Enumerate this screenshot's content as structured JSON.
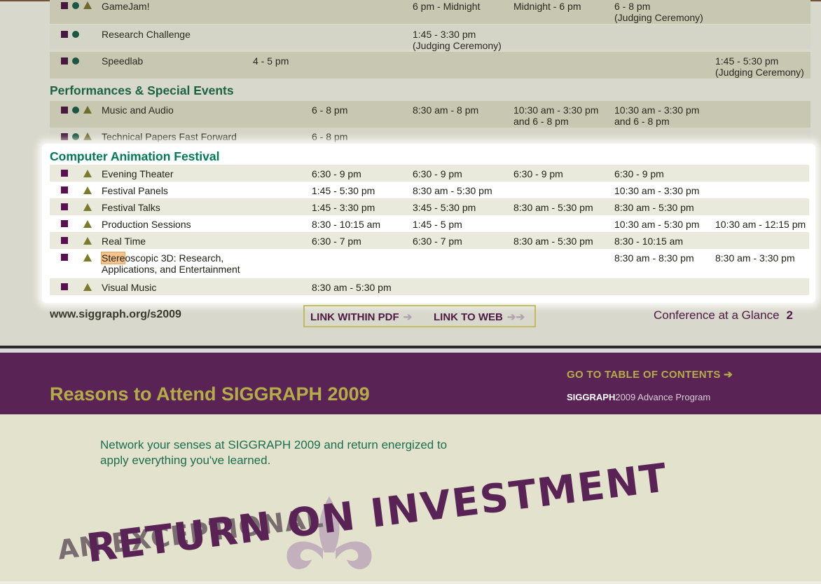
{
  "page1": {
    "upper_rows": [
      {
        "name": "GameJam!",
        "cells": [
          "",
          "",
          "6 pm - Midnight",
          "Midnight - 6 pm",
          "6 - 8 pm\n(Judging Ceremony)",
          ""
        ]
      },
      {
        "name": "Research Challenge",
        "cells": [
          "",
          "",
          "1:45 - 3:30 pm\n(Judging Ceremony)",
          "",
          "",
          ""
        ]
      },
      {
        "name": "Speedlab",
        "cells": [
          "4 - 5 pm",
          "",
          "",
          "",
          "",
          "1:45 - 5:30 pm\n(Judging Ceremony)"
        ]
      }
    ],
    "performances_section": "Performances & Special Events",
    "performances_rows": [
      {
        "name": "Music and Audio",
        "cells": [
          "6 - 8 pm",
          "8:30 am - 8 pm",
          "10:30 am - 3:30 pm\nand 6 - 8 pm",
          "10:30 am - 3:30 pm\nand 6 - 8 pm",
          ""
        ]
      },
      {
        "name": "Technical Papers Fast Forward",
        "cells": [
          "6 - 8 pm",
          "",
          "",
          "",
          ""
        ]
      }
    ],
    "caf": {
      "section": "Computer Animation Festival",
      "rows": [
        {
          "name": "Evening Theater",
          "cells": [
            "6:30 - 9 pm",
            "6:30 - 9 pm",
            "6:30 - 9 pm",
            "6:30 - 9 pm",
            ""
          ]
        },
        {
          "name": "Festival Panels",
          "cells": [
            "1:45 - 5:30 pm",
            "8:30 am - 5:30 pm",
            "",
            "10:30 am - 3:30 pm",
            ""
          ]
        },
        {
          "name": "Festival Talks",
          "cells": [
            "1:45 - 3:30 pm",
            "3:45 - 5:30 pm",
            "8:30 am - 5:30 pm",
            "8:30 am - 5:30 pm",
            ""
          ]
        },
        {
          "name": "Production Sessions",
          "cells": [
            "8:30 - 10:15 am",
            "1:45 - 5 pm",
            "",
            "10:30 am - 5:30 pm",
            "10:30 am - 12:15 pm"
          ]
        },
        {
          "name": "Real Time",
          "cells": [
            "6:30 - 7 pm",
            "6:30 - 7 pm",
            "8:30 am - 5:30 pm",
            "8:30 - 10:15 am",
            ""
          ]
        },
        {
          "name_highlight": "Stere",
          "name_rest": "oscopic 3D: Research,\nApplications, and Entertainment",
          "cells": [
            "",
            "",
            "",
            "8:30 am - 8:30 pm",
            "8:30 am - 3:30 pm"
          ]
        },
        {
          "name": "Visual Music",
          "cells": [
            "8:30 am - 5:30 pm",
            "",
            "",
            "",
            ""
          ]
        }
      ]
    },
    "footer": {
      "url": "www.siggraph.org/s2009",
      "link_pdf": "LINK WITHIN PDF",
      "link_web": "LINK TO WEB",
      "arrow_single": "➔",
      "arrow_double": "➔➔",
      "glance": "Conference at a Glance",
      "page_number": "2"
    }
  },
  "page2": {
    "toc_link": "GO TO TABLE OF CONTENTS",
    "toc_arrow": "➔",
    "program_bold": "SIGGRAPH",
    "program_rest": "2009 Advance Program",
    "title": "Reasons to Attend SIGGRAPH 2009",
    "tagline": "Network your senses at SIGGRAPH 2009 and return energized to apply everything you've learned.",
    "art_line1": "AN EXCEPTIONAL",
    "art_line2": "RETURN ON INVESTMENT"
  }
}
